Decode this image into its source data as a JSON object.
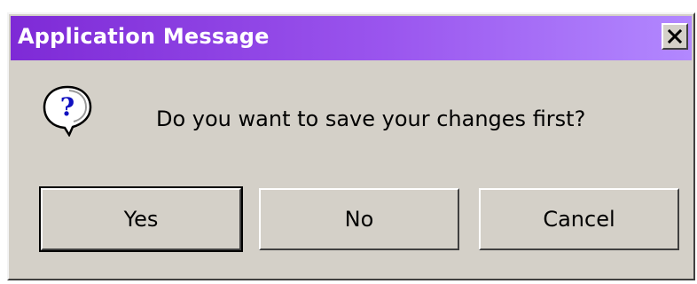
{
  "dialog": {
    "title": "Application Message",
    "close_icon": "close-icon",
    "message": "Do you want to save your changes first?",
    "icon": "question-icon",
    "buttons": {
      "yes": "Yes",
      "no": "No",
      "cancel": "Cancel"
    }
  },
  "colors": {
    "titlebar_start": "#7e2ad6",
    "titlebar_end": "#b288ff",
    "face": "#d4d0c8"
  }
}
